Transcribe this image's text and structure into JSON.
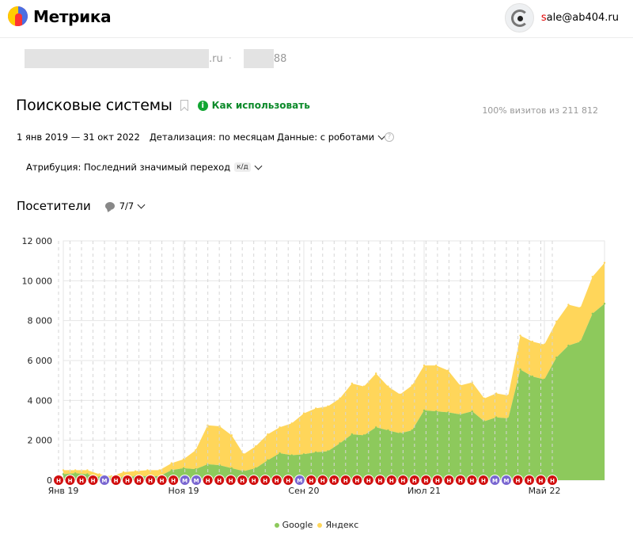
{
  "header": {
    "logo_text": "Метрика",
    "user_email_first": "s",
    "user_email_rest": "ale@ab404.ru"
  },
  "site": {
    "domain_suffix": ".ru",
    "separator": "·",
    "counter_suffix": "88"
  },
  "report": {
    "title": "Поисковые системы",
    "howto_label": "Как использовать",
    "visits_share": "100% визитов из 211 812",
    "date_range": "1 янв 2019 — 31 окт 2022",
    "detail_label": "Детализация: по месяцам",
    "data_label": "Данные: с роботами",
    "help_glyph": "?",
    "attribution_label": "Атрибуция: Последний значимый переход",
    "attribution_badge": "к/д"
  },
  "viz": {
    "title": "Посетители",
    "segments": "7/7"
  },
  "colors": {
    "google": "#8dc95c",
    "yandex": "#ffd65a",
    "marker_red": "#d10f0f",
    "marker_purple": "#7a67d1",
    "accent_green": "#0c8a2a"
  },
  "legend": [
    {
      "name": "Google",
      "color": "#8dc95c"
    },
    {
      "name": "Яндекс",
      "color": "#ffd65a"
    }
  ],
  "chart_data": {
    "type": "area",
    "stacked": true,
    "y_ticks": [
      "12 000",
      "10 000",
      "8 000",
      "6 000",
      "4 000",
      "2 000",
      "0"
    ],
    "ylim": [
      0,
      12000
    ],
    "x_tick_labels": [
      "Янв 19",
      "Ноя 19",
      "Сен 20",
      "Июл 21",
      "Май 22"
    ],
    "x_tick_indices": [
      0,
      10,
      20,
      30,
      40
    ],
    "series": [
      {
        "name": "Google",
        "values": [
          300,
          350,
          300,
          150,
          100,
          150,
          200,
          200,
          200,
          500,
          600,
          550,
          800,
          750,
          600,
          450,
          600,
          1000,
          1350,
          1250,
          1300,
          1400,
          1450,
          1850,
          2300,
          2250,
          2650,
          2500,
          2350,
          2500,
          3500,
          3450,
          3400,
          3300,
          3450,
          2950,
          3150,
          3100,
          5550,
          5200,
          5050,
          6150,
          6750,
          6950,
          8350,
          8850
        ]
      },
      {
        "name": "Яндекс",
        "values": [
          200,
          150,
          200,
          150,
          100,
          250,
          250,
          300,
          300,
          350,
          450,
          950,
          1950,
          1950,
          1650,
          850,
          1100,
          1300,
          1300,
          1600,
          2050,
          2200,
          2250,
          2250,
          2550,
          2450,
          2700,
          2200,
          1950,
          2250,
          2250,
          2300,
          2100,
          1450,
          1450,
          1150,
          1200,
          1150,
          1700,
          1750,
          1750,
          1800,
          2050,
          1700,
          1850,
          2050
        ]
      }
    ],
    "annotations": [
      "Н",
      "Н",
      "Н",
      "Н",
      "М",
      "Н",
      "Н",
      "Н",
      "Н",
      "Н",
      "Н",
      "М",
      "М",
      "Н",
      "Н",
      "Н",
      "Н",
      "Н",
      "Н",
      "Н",
      "Н",
      "М",
      "Н",
      "Н",
      "Н",
      "Н",
      "Н",
      "Н",
      "Н",
      "Н",
      "Н",
      "Н",
      "Н",
      "Н",
      "Н",
      "Н",
      "Н",
      "Н",
      "М",
      "М",
      "Н",
      "Н",
      "Н",
      "Н"
    ],
    "grid": true,
    "legend_position": "bottom"
  }
}
